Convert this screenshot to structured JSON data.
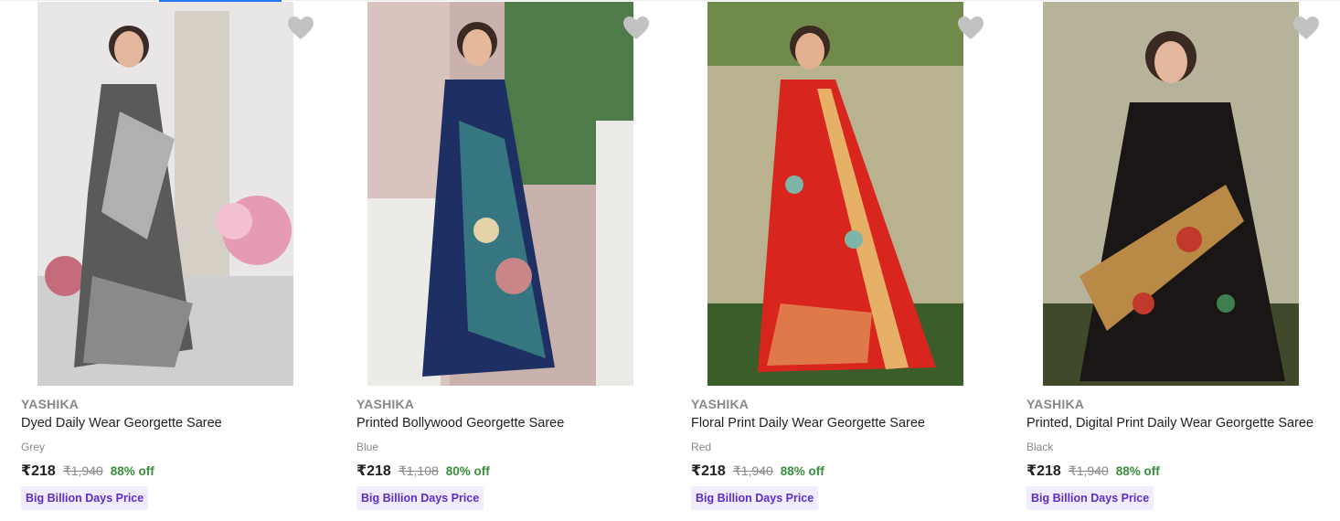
{
  "products": [
    {
      "brand": "YASHIKA",
      "title": "Dyed Daily Wear Georgette Saree",
      "color": "Grey",
      "price": "₹218",
      "mrp": "₹1,940",
      "discount": "88% off",
      "badge": "Big Billion Days Price",
      "image_icon": "saree-image-grey",
      "colors": {
        "bg": "#dcdcdc",
        "saree": "#5a5a5a",
        "accent": "#b0b0b0"
      }
    },
    {
      "brand": "YASHIKA",
      "title": "Printed Bollywood Georgette Saree",
      "color": "Blue",
      "price": "₹218",
      "mrp": "₹1,108",
      "discount": "80% off",
      "badge": "Big Billion Days Price",
      "image_icon": "saree-image-blue",
      "colors": {
        "bg": "#c9b2ad",
        "saree": "#1d2f63",
        "accent": "#3e8f8a"
      }
    },
    {
      "brand": "YASHIKA",
      "title": "Floral Print Daily Wear Georgette Saree",
      "color": "Red",
      "price": "₹218",
      "mrp": "₹1,940",
      "discount": "88% off",
      "badge": "Big Billion Days Price",
      "image_icon": "saree-image-red",
      "colors": {
        "bg": "#b9b28e",
        "saree": "#d8261e",
        "accent": "#e6b067"
      }
    },
    {
      "brand": "YASHIKA",
      "title": "Printed, Digital Print Daily Wear Georgette Saree",
      "color": "Black",
      "price": "₹218",
      "mrp": "₹1,940",
      "discount": "88% off",
      "badge": "Big Billion Days Price",
      "image_icon": "saree-image-black",
      "colors": {
        "bg": "#b7b39a",
        "saree": "#1b1616",
        "accent": "#b98a45"
      }
    }
  ],
  "wishlist_icon": "heart-icon"
}
